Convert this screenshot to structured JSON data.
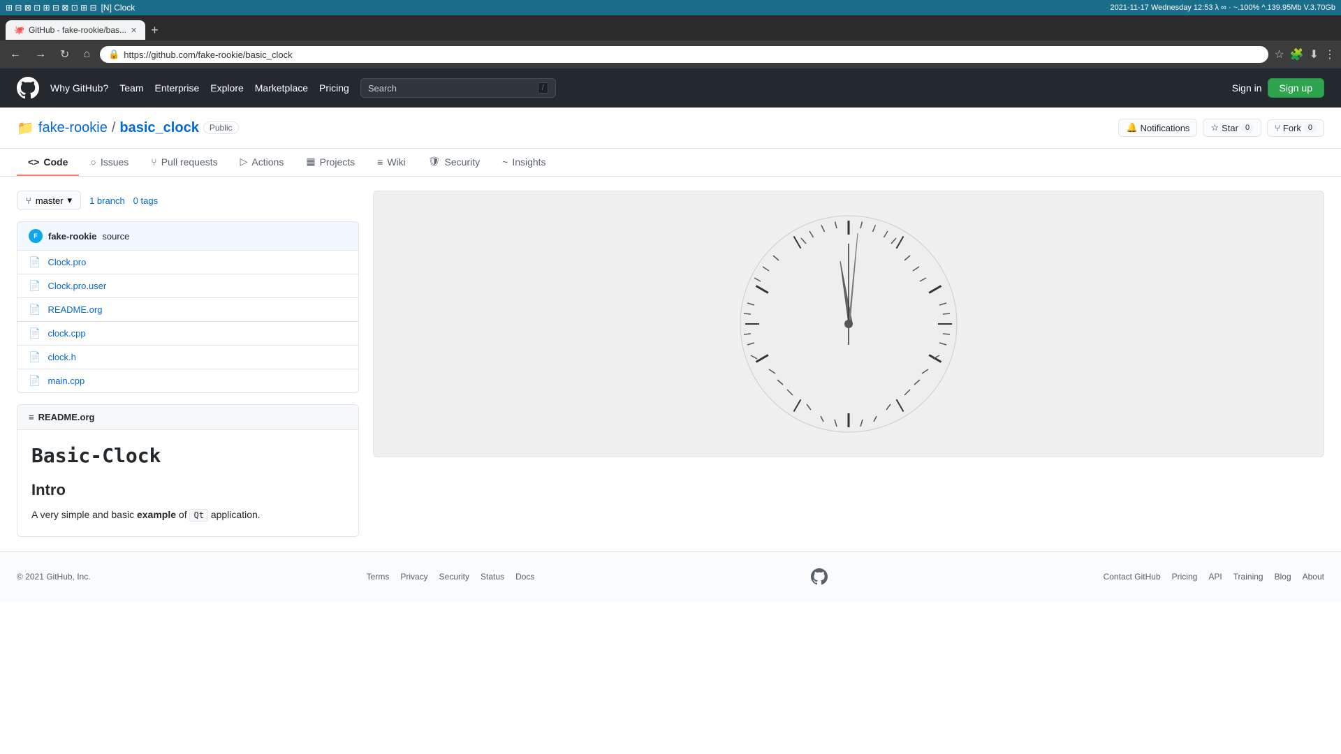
{
  "os_bar": {
    "left": "[N] Clock",
    "right": "2021-11-17 Wednesday 12:53 λ ∞ · ~.100% ^.139.95Mb V.3.70Gb"
  },
  "browser": {
    "tab_title": "GitHub - fake-rookie/bas...",
    "url": "https://github.com/fake-rookie/basic_clock"
  },
  "github_nav": {
    "why_github": "Why GitHub?",
    "team": "Team",
    "enterprise": "Enterprise",
    "explore": "Explore",
    "marketplace": "Marketplace",
    "pricing": "Pricing",
    "search_placeholder": "Search",
    "search_kbd": "/",
    "signin": "Sign in",
    "signup": "Sign up"
  },
  "repo": {
    "owner": "fake-rookie",
    "name": "basic_clock",
    "visibility": "Public",
    "notifications_label": "Notifications",
    "star_label": "Star",
    "star_count": "0",
    "fork_label": "Fork",
    "fork_count": "0"
  },
  "tabs": [
    {
      "label": "Code",
      "icon": "<>",
      "active": true
    },
    {
      "label": "Issues",
      "icon": "○",
      "active": false
    },
    {
      "label": "Pull requests",
      "icon": "⑂",
      "active": false
    },
    {
      "label": "Actions",
      "icon": "▷",
      "active": false
    },
    {
      "label": "Projects",
      "icon": "▦",
      "active": false
    },
    {
      "label": "Wiki",
      "icon": "≡",
      "active": false
    },
    {
      "label": "Security",
      "icon": "🛡",
      "active": false
    },
    {
      "label": "Insights",
      "icon": "~",
      "active": false
    }
  ],
  "branch": {
    "name": "master",
    "branch_count": "1 branch",
    "tag_count": "0 tags"
  },
  "file_list": {
    "header_user": "fake-rookie",
    "header_message": "source",
    "files": [
      {
        "name": "Clock.pro"
      },
      {
        "name": "Clock.pro.user"
      },
      {
        "name": "README.org"
      },
      {
        "name": "clock.cpp"
      },
      {
        "name": "clock.h"
      },
      {
        "name": "main.cpp"
      }
    ]
  },
  "readme": {
    "header": "README.org",
    "title": "Basic-Clock",
    "intro": "Intro",
    "text_before": "A very simple and basic ",
    "text_bold": "example",
    "text_middle": " of ",
    "text_code": "Qt",
    "text_after": " application."
  },
  "footer": {
    "copyright": "© 2021 GitHub, Inc.",
    "links": [
      "Terms",
      "Privacy",
      "Security",
      "Status",
      "Docs"
    ],
    "right_links": [
      "Contact GitHub",
      "Pricing",
      "API",
      "Training",
      "Blog",
      "About"
    ]
  }
}
